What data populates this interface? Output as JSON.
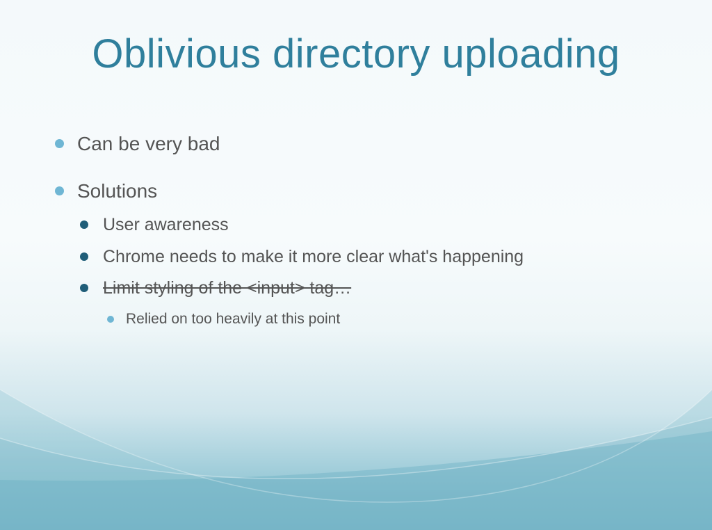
{
  "slide": {
    "title": "Oblivious directory uploading",
    "bullets": [
      {
        "text": "Can be very bad"
      },
      {
        "text": "Solutions",
        "children": [
          {
            "text": "User awareness"
          },
          {
            "text": "Chrome needs to make it more clear what's happening"
          },
          {
            "text": "Limit styling of the <input> tag…",
            "struck": true,
            "children": [
              {
                "text": "Relied on too heavily at this point"
              }
            ]
          }
        ]
      }
    ]
  },
  "colors": {
    "title": "#2f7f9c",
    "bullet_light": "#6fb6d4",
    "bullet_dark": "#1f5d78",
    "text": "#545454"
  }
}
